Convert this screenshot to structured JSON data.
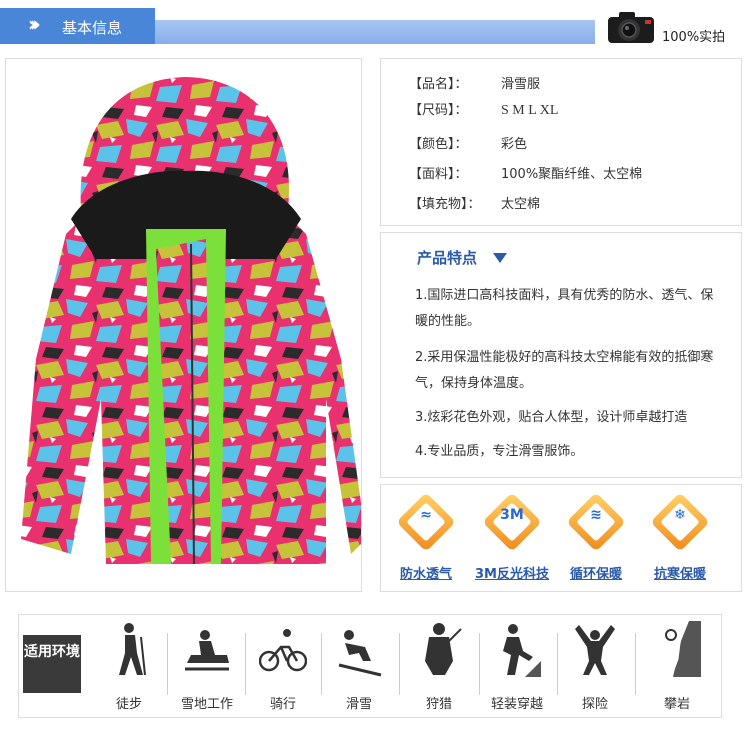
{
  "header": {
    "title": "基本信息",
    "camera_text": "100%实拍"
  },
  "info": {
    "rows": [
      {
        "label": "【品名】：",
        "value": "滑雪服"
      },
      {
        "label": "【尺码】：",
        "value": "S  M  L  XL"
      },
      {
        "label": "【颜色】：",
        "value": "彩色"
      },
      {
        "label": "【面料】：",
        "value": "100%聚酯纤维、太空棉"
      },
      {
        "label": "【填充物】：",
        "value": "太空棉"
      }
    ]
  },
  "features": {
    "title": "产品特点",
    "items": [
      "1.国际进口高科技面料，具有优秀的防水、透气、保暖的性能。",
      "2.采用保温性能极好的高科技太空棉能有效的抵御寒气，保持身体温度。",
      "3.炫彩花色外观，贴合人体型，设计师卓越打造",
      "4.专业品质，专注滑雪服饰。"
    ]
  },
  "feature_icons": [
    {
      "label": "防水透气",
      "icon": "waterproof-icon",
      "glyph": "≈"
    },
    {
      "label": "3M反光科技",
      "icon": "3m-icon",
      "glyph": "3M"
    },
    {
      "label": "循环保暖",
      "icon": "warmth-icon",
      "glyph": "≋"
    },
    {
      "label": "抗寒保暖",
      "icon": "cold-resist-icon",
      "glyph": "❄"
    }
  ],
  "activities": {
    "badge": "适用环境",
    "items": [
      {
        "label": "徒步",
        "icon": "hiking-icon"
      },
      {
        "label": "雪地工作",
        "icon": "snowmobile-icon"
      },
      {
        "label": "骑行",
        "icon": "cycling-icon"
      },
      {
        "label": "滑雪",
        "icon": "skiing-icon"
      },
      {
        "label": "狩猎",
        "icon": "hunting-icon"
      },
      {
        "label": "轻装穿越",
        "icon": "trekking-icon"
      },
      {
        "label": "探险",
        "icon": "exploring-icon"
      },
      {
        "label": "攀岩",
        "icon": "climbing-icon"
      }
    ]
  },
  "colors": {
    "header_blue": "#4a86d8",
    "title_blue": "#2a5aa8",
    "badge_dark": "#3a3a3a"
  }
}
